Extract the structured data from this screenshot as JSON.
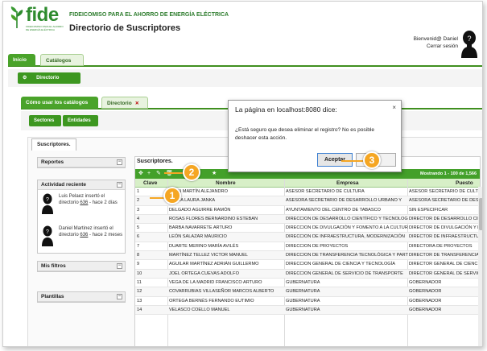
{
  "brand": {
    "logo_text": "fide",
    "logo_subtext": "FIDEICOMISO PARA EL AHORRO DE ENERGÍA ELÉCTRICA",
    "org_name": "FIDEICOMISO PARA EL AHORRO DE ENERGÍA ELÉCTRICA",
    "page_title": "Directorio de Suscriptores",
    "green": "#3d9720"
  },
  "user": {
    "greeting": "Bienvenid@ Daniel",
    "logout": "Cerrar sesión"
  },
  "nav": {
    "tabs": [
      {
        "label": "Inicio"
      },
      {
        "label": "Catálogos"
      }
    ],
    "sub_button": "Directorio"
  },
  "inner": {
    "tabs": [
      {
        "label": "Cómo usar los catálogos"
      },
      {
        "label": "Directorio"
      }
    ],
    "close_glyph": "✕",
    "buttons": [
      {
        "label": "Sectores"
      },
      {
        "label": "Entidades"
      }
    ],
    "subs_tab": "Suscriptores."
  },
  "sidebar": {
    "reportes": "Reportes",
    "actividad": "Actividad reciente",
    "activities": [
      {
        "prefix": "Luis Pelaez insertó el directorio",
        "link": "636",
        "suffix": "- hace 2 días"
      },
      {
        "prefix": "Daniel Martinez insertó el directorio",
        "link": "636",
        "suffix": "- hace 2 meses"
      }
    ],
    "filtros": "Mis filtros",
    "plantillas": "Plantillas"
  },
  "grid": {
    "title": "Suscriptores.",
    "showing": "Mostrando 1 - 100 de 1,566",
    "headers": {
      "clave": "Clave",
      "nombre": "Nombre",
      "empresa": "Empresa",
      "puesto": "Puesto"
    },
    "rows": [
      {
        "n": "1",
        "nombre": "LEÓN MARTÍN ALEJANDRO",
        "empresa": "ASESOR SECRETARIO DE CULTURA",
        "puesto": "ASESOR SECRETARIO DE CULTURA Y"
      },
      {
        "n": "2",
        "nombre": "PAULA LAURA JANKA",
        "empresa": "ASESORA SECRETARIO DE DESARROLLO URBANO Y",
        "puesto": "ASESORA SECRETARIO DE DESARROLLO"
      },
      {
        "n": "3",
        "nombre": "DELGADO AGUIRRE RAMÓN",
        "empresa": "AYUNTAMIENTO DEL CENTRO DE TABASCO",
        "puesto": "SIN ESPECIFICAR"
      },
      {
        "n": "4",
        "nombre": "ROSAS FLORES BERNARDINO ESTEBAN",
        "empresa": "DIRECCION DE DESARROLLO CIENTÍFICO Y TECNOLOGICO",
        "puesto": "DIRECTOR DE DESARROLLO CIENTÍFICO"
      },
      {
        "n": "5",
        "nombre": "BARBA NAVARRETE ARTURO",
        "empresa": "DIRECCION DE DIVULGACIÓN Y FOMENTO A LA CULTURA",
        "puesto": "DIRECTOR DE DIVULGACIÓN Y FOMENTO"
      },
      {
        "n": "6",
        "nombre": "LEÓN SALAZAR MAURICIO",
        "empresa": "DIRECCION DE INFRAESTRUCTURA, MODERNIZACIÓN",
        "puesto": "DIRECTOR DE INFRAESTRUCTURA,"
      },
      {
        "n": "7",
        "nombre": "DUARTE MERINO MARÍA AVILÉS",
        "empresa": "DIRECCION DE PROYECTOS",
        "puesto": "DIRECTORA DE PROYECTOS"
      },
      {
        "n": "8",
        "nombre": "MARTÍNEZ TELLEZ VICTOR MANUEL",
        "empresa": "DIRECCION DE TRANSFERENCIA TECNOLÓGICA Y PARTICIPACION",
        "puesto": "DIRECTOR DE TRANSFERENCIA TECNOLÓGICA"
      },
      {
        "n": "9",
        "nombre": "AGUILAR MARTÍNEZ ADRIÁN GUILLERMO",
        "empresa": "DIRECCION GENERAL DE CIENCIA Y TECNOLOGÍA",
        "puesto": "DIRECTOR GENERAL DE CIENCIA Y TECNOLOGÍA"
      },
      {
        "n": "10",
        "nombre": "JOEL ORTEGA CUEVAS ADOLFO",
        "empresa": "DIRECCION GENERAL DE SERVICIO DE TRANSPORTE",
        "puesto": "DIRECTOR GENERAL DE SERVICIO DE"
      },
      {
        "n": "11",
        "nombre": "VEGA DE LA MADRID FRANCISCO ARTURO",
        "empresa": "GUBERNATURA",
        "puesto": "GOBERNADOR"
      },
      {
        "n": "12",
        "nombre": "COVARRUBIAS VILLASEÑOR MARCOS ALBERTO",
        "empresa": "GUBERNATURA",
        "puesto": "GOBERNADOR"
      },
      {
        "n": "13",
        "nombre": "ORTEGA BERNÉS FERNANDO EUTIMIO",
        "empresa": "GUBERNATURA",
        "puesto": "GOBERNADOR"
      },
      {
        "n": "14",
        "nombre": "VELASCO COELLO MANUEL",
        "empresa": "GUBERNATURA",
        "puesto": "GOBERNADOR"
      }
    ]
  },
  "dialog": {
    "title": "La página en localhost:8080 dice:",
    "close": "×",
    "message": "¿Está seguro que desea eliminar el registro? No es posible deshacer esta acción.",
    "ok": "Aceptar"
  },
  "callouts": [
    "1",
    "2",
    "3"
  ],
  "callout_color": "#f5a623"
}
